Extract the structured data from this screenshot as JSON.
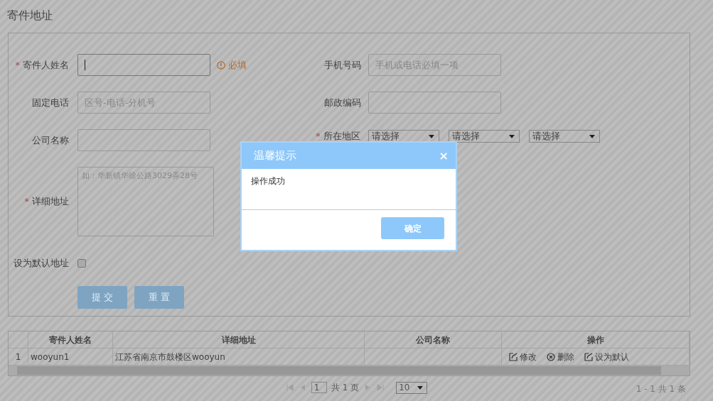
{
  "page_title": "寄件地址",
  "left_fields": [
    {
      "kind": "text",
      "label": "寄件人姓名",
      "required_mark": "*",
      "focused": true,
      "hint": "必填"
    },
    {
      "kind": "text",
      "label": "固定电话",
      "placeholder": "区号-电话-分机号",
      "focused": false
    },
    {
      "kind": "text",
      "label": "公司名称",
      "focused": false
    },
    {
      "kind": "textarea",
      "label": "详细地址",
      "required_mark": "*",
      "placeholder": "如：华新镇华徐公路3029弄28号",
      "focused": false
    },
    {
      "kind": "checkbox",
      "label": "设为默认地址",
      "checked": false
    }
  ],
  "right_fields": [
    {
      "kind": "text",
      "label": "手机号码",
      "placeholder": "手机或电话必填一项"
    },
    {
      "kind": "text",
      "label": "邮政编码"
    },
    {
      "kind": "selects",
      "label": "所在地区",
      "required_mark": "*",
      "options": [
        "请选择",
        "请选择",
        "请选择"
      ]
    }
  ],
  "buttons": [
    "提 交",
    "重 置"
  ],
  "table": {
    "columns": [
      "寄件人姓名",
      "详细地址",
      "公司名称",
      "操作"
    ],
    "rows": [
      {
        "index": "1",
        "sender": "wooyun1",
        "address": "江苏省南京市鼓楼区wooyun",
        "actions": [
          {
            "kind": "edit",
            "label": "修改"
          },
          {
            "kind": "delete",
            "label": "删除"
          },
          {
            "kind": "edit",
            "label": "设为默认"
          }
        ]
      }
    ]
  },
  "pager": {
    "page": "1",
    "pages": "共 1 页",
    "page_size": "10",
    "summary": "1 - 1  共 1 条"
  },
  "modal": {
    "title": "温馨提示",
    "close": "×",
    "message": "操作成功",
    "button": "确定"
  }
}
